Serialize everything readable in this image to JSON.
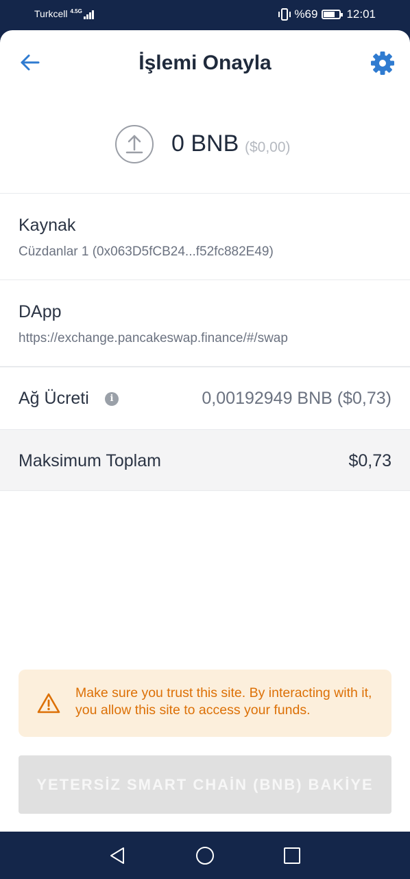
{
  "status_bar": {
    "carrier": "Turkcell",
    "network": "4.5G",
    "battery_text": "%69",
    "battery_level": 0.69,
    "time": "12:01"
  },
  "header": {
    "title": "İşlemi Onayla",
    "back_icon": "arrow-left-icon",
    "settings_icon": "gear-icon"
  },
  "amount": {
    "value": "0 BNB",
    "fiat": "($0,00)",
    "icon": "upload-icon"
  },
  "source": {
    "label": "Kaynak",
    "value": "Cüzdanlar 1 (0x063D5fCB24...f52fc882E49)"
  },
  "dapp": {
    "label": "DApp",
    "value": "https://exchange.pancakeswap.finance/#/swap"
  },
  "network_fee": {
    "label": "Ağ Ücreti",
    "info_icon": "i",
    "value": "0,00192949 BNB ($0,73)"
  },
  "max_total": {
    "label": "Maksimum Toplam",
    "value": "$0,73"
  },
  "warning": {
    "icon": "warning-triangle-icon",
    "text": "Make sure you trust this site. By interacting with it, you allow this site to access your funds."
  },
  "submit": {
    "label": "YETERSİZ SMART CHAİN (BNB) BAKİYE",
    "enabled": false
  },
  "nav_bar": {
    "icons": [
      "back-triangle-icon",
      "home-circle-icon",
      "recents-square-icon"
    ]
  },
  "colors": {
    "accent": "#2f7bd0",
    "status_bar_bg": "#14264a",
    "warning_bg": "#fcefdc",
    "warning_text": "#dc7006",
    "disabled_button": "#e0e0e0"
  }
}
